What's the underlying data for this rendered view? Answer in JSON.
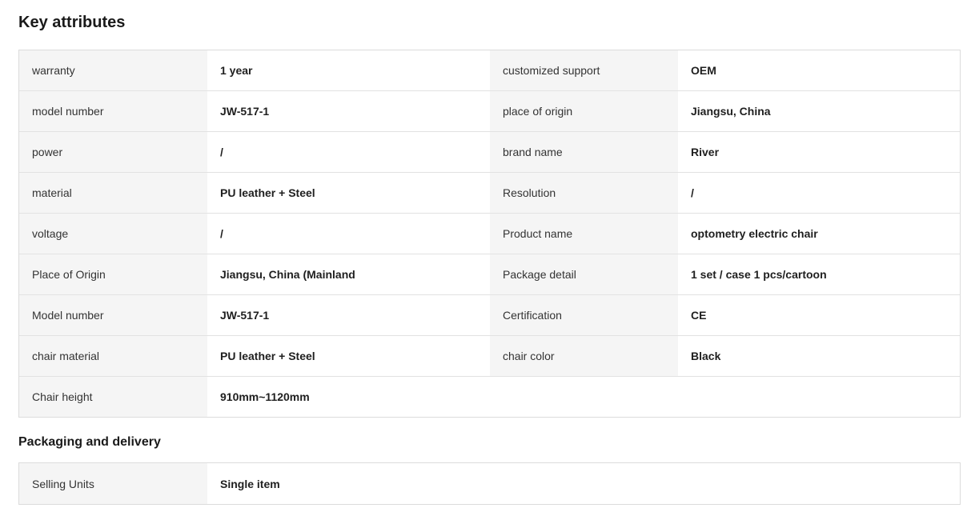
{
  "key_attributes": {
    "title": "Key attributes",
    "rows": [
      {
        "left_label": "warranty",
        "left_value": "1 year",
        "right_label": "customized support",
        "right_value": "OEM"
      },
      {
        "left_label": "model number",
        "left_value": "JW-517-1",
        "right_label": "place of origin",
        "right_value": "Jiangsu, China"
      },
      {
        "left_label": "power",
        "left_value": "/",
        "right_label": "brand name",
        "right_value": "River"
      },
      {
        "left_label": "material",
        "left_value": "PU leather + Steel",
        "right_label": "Resolution",
        "right_value": "/"
      },
      {
        "left_label": "voltage",
        "left_value": "/",
        "right_label": "Product name",
        "right_value": "optometry electric chair"
      },
      {
        "left_label": "Place of Origin",
        "left_value": "Jiangsu, China (Mainland",
        "right_label": "Package detail",
        "right_value": "1 set / case 1 pcs/cartoon"
      },
      {
        "left_label": "Model number",
        "left_value": "JW-517-1",
        "right_label": "Certification",
        "right_value": "CE"
      },
      {
        "left_label": "chair material",
        "left_value": "PU leather + Steel",
        "right_label": "chair color",
        "right_value": "Black"
      },
      {
        "left_label": "Chair height",
        "left_value": "910mm~1120mm"
      }
    ]
  },
  "packaging": {
    "title": "Packaging and delivery",
    "rows": [
      {
        "label": "Selling Units",
        "value": "Single item"
      }
    ]
  }
}
